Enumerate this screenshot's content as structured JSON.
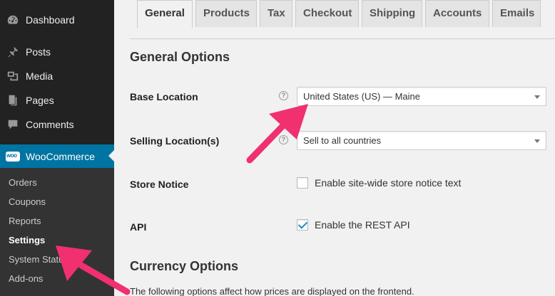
{
  "sidebar": {
    "items": [
      {
        "label": "Dashboard",
        "icon": "dashboard-icon"
      },
      {
        "label": "Posts",
        "icon": "pin-icon"
      },
      {
        "label": "Media",
        "icon": "media-icon"
      },
      {
        "label": "Pages",
        "icon": "pages-icon"
      },
      {
        "label": "Comments",
        "icon": "comment-icon"
      },
      {
        "label": "WooCommerce",
        "icon": "woocommerce-icon"
      }
    ],
    "submenu": [
      "Orders",
      "Coupons",
      "Reports",
      "Settings",
      "System Status",
      "Add-ons"
    ],
    "current_submenu": "Settings"
  },
  "tabs": [
    "General",
    "Products",
    "Tax",
    "Checkout",
    "Shipping",
    "Accounts",
    "Emails"
  ],
  "active_tab": "General",
  "general": {
    "title": "General Options",
    "base_location": {
      "label": "Base Location",
      "value": "United States (US) — Maine"
    },
    "selling_locations": {
      "label": "Selling Location(s)",
      "value": "Sell to all countries"
    },
    "store_notice": {
      "label": "Store Notice",
      "checkbox_label": "Enable site-wide store notice text",
      "checked": false
    },
    "api": {
      "label": "API",
      "checkbox_label": "Enable the REST API",
      "checked": true
    },
    "help_symbol": "?"
  },
  "currency": {
    "title": "Currency Options",
    "description": "The following options affect how prices are displayed on the frontend."
  },
  "colors": {
    "accent": "#0074a2",
    "annotation_arrow": "#f0306f"
  }
}
